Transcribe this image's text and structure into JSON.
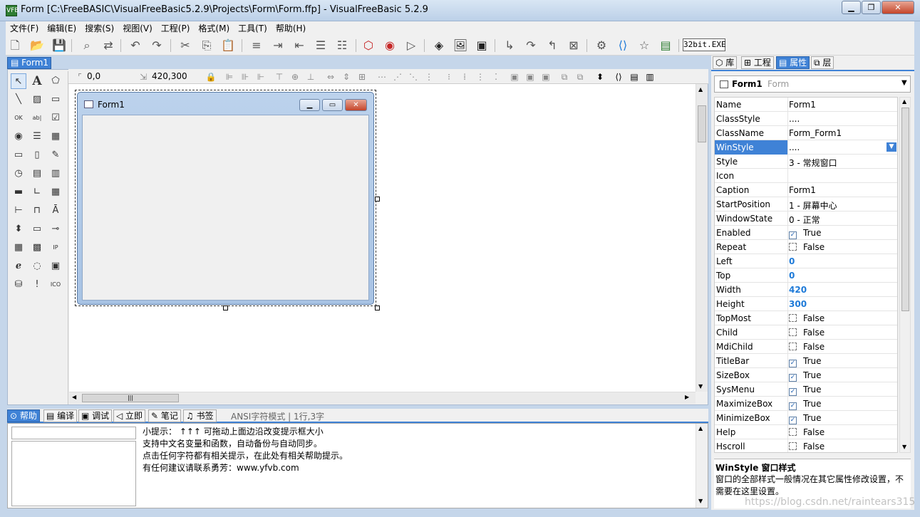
{
  "window": {
    "title": "Form [C:\\FreeBASIC\\VisualFreeBasic5.2.9\\Projects\\Form\\Form.ffp] - VisualFreeBasic 5.2.9",
    "app_icon": "VFB"
  },
  "menu": [
    "文件(F)",
    "编辑(E)",
    "搜索(S)",
    "视图(V)",
    "工程(P)",
    "格式(M)",
    "工具(T)",
    "帮助(H)"
  ],
  "toolbar": {
    "bitness": "32bit.EXE"
  },
  "doc_tab": "Form1",
  "coords": {
    "position": "0,0",
    "size": "420,300"
  },
  "design_form": {
    "caption": "Form1"
  },
  "bottom_tabs": [
    "帮助",
    "编译",
    "调试",
    "立即",
    "笔记",
    "书签"
  ],
  "status": "ANSI字符模式 | 1行,3字",
  "help_lines": [
    "小提示： ↑↑↑ 可拖动上面边沿改变提示框大小",
    "支持中文名变量和函数，自动备份与自动同步。",
    "点击任何字符都有相关提示，在此处有相关帮助提示。",
    "有任何建议请联系勇芳：www.yfvb.com"
  ],
  "right_tabs": [
    "库",
    "工程",
    "属性",
    "层"
  ],
  "object_combo": {
    "name": "Form1",
    "type": "Form"
  },
  "properties": [
    {
      "name": "Name",
      "value": "Form1"
    },
    {
      "name": "ClassStyle",
      "value": "...."
    },
    {
      "name": "ClassName",
      "value": "Form_Form1"
    },
    {
      "name": "WinStyle",
      "value": "...."
    },
    {
      "name": "Style",
      "value": "3 - 常规窗口"
    },
    {
      "name": "Icon",
      "value": ""
    },
    {
      "name": "Caption",
      "value": "Form1"
    },
    {
      "name": "StartPosition",
      "value": "1 - 屏幕中心"
    },
    {
      "name": "WindowState",
      "value": "0 - 正常"
    },
    {
      "name": "Enabled",
      "value": "True"
    },
    {
      "name": "Repeat",
      "value": "False"
    },
    {
      "name": "Left",
      "value": "0"
    },
    {
      "name": "Top",
      "value": "0"
    },
    {
      "name": "Width",
      "value": "420"
    },
    {
      "name": "Height",
      "value": "300"
    },
    {
      "name": "TopMost",
      "value": "False"
    },
    {
      "name": "Child",
      "value": "False"
    },
    {
      "name": "MdiChild",
      "value": "False"
    },
    {
      "name": "TitleBar",
      "value": "True"
    },
    {
      "name": "SizeBox",
      "value": "True"
    },
    {
      "name": "SysMenu",
      "value": "True"
    },
    {
      "name": "MaximizeBox",
      "value": "True"
    },
    {
      "name": "MinimizeBox",
      "value": "True"
    },
    {
      "name": "Help",
      "value": "False"
    },
    {
      "name": "Hscroll",
      "value": "False"
    }
  ],
  "description": {
    "title": "WinStyle  窗口样式",
    "text": "窗口的全部样式一般情况在其它属性修改设置，不需要在这里设置。"
  },
  "watermark": "https://blog.csdn.net/raintears315",
  "colors": {
    "accent": "#3f82d6",
    "numeric": "#1e7ad8"
  }
}
